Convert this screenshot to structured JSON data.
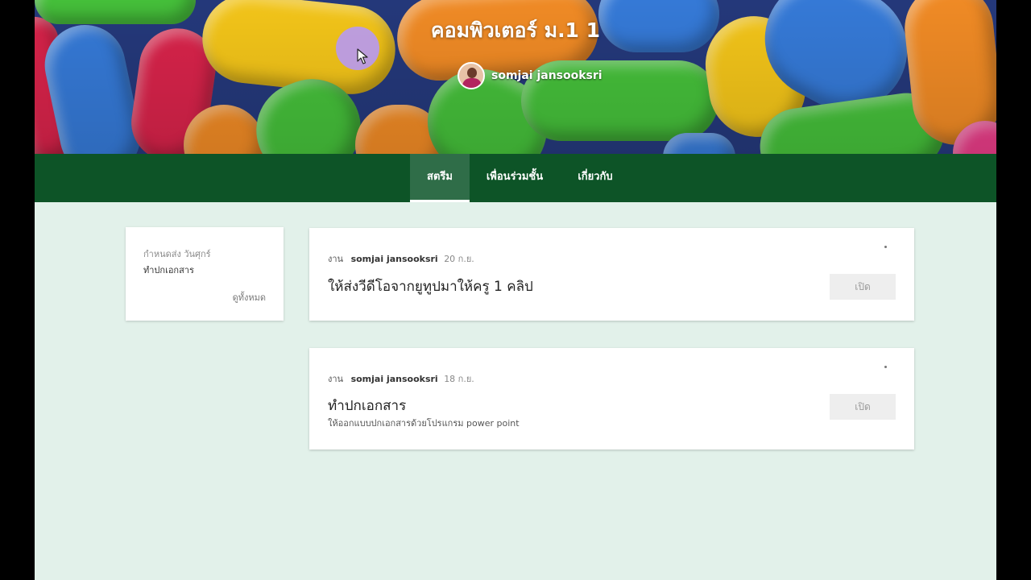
{
  "header": {
    "class_title": "คอมพิวเตอร์ ม.1 1",
    "teacher_name": "somjai jansooksri"
  },
  "tabs": [
    {
      "label": "สตรีม",
      "active": true
    },
    {
      "label": "เพื่อนร่วมชั้น",
      "active": false
    },
    {
      "label": "เกี่ยวกับ",
      "active": false
    }
  ],
  "upcoming": {
    "due": "กำหนดส่ง วันศุกร์",
    "item": "ทำปกเอกสาร",
    "view_all": "ดูทั้งหมด"
  },
  "posts": [
    {
      "type": "งาน",
      "author": "somjai jansooksri",
      "date": "20 ก.ย.",
      "title": "ให้ส่งวีดีโอจากยูทูปมาให้ครู 1 คลิป",
      "description": "",
      "button": "เปิด"
    },
    {
      "type": "งาน",
      "author": "somjai jansooksri",
      "date": "18 ก.ย.",
      "title": "ทำปกเอกสาร",
      "description": "ให้ออกแบบปกเอกสารด้วยโปรแกรม power point",
      "button": "เปิด"
    }
  ],
  "colors": {
    "tab_bar": "#0d5427",
    "page_background": "#e2f1ea",
    "cursor_highlight": "#b496ff"
  },
  "icons": {
    "cursor": "mouse-pointer-icon",
    "post_menu": "more-vertical-icon"
  }
}
